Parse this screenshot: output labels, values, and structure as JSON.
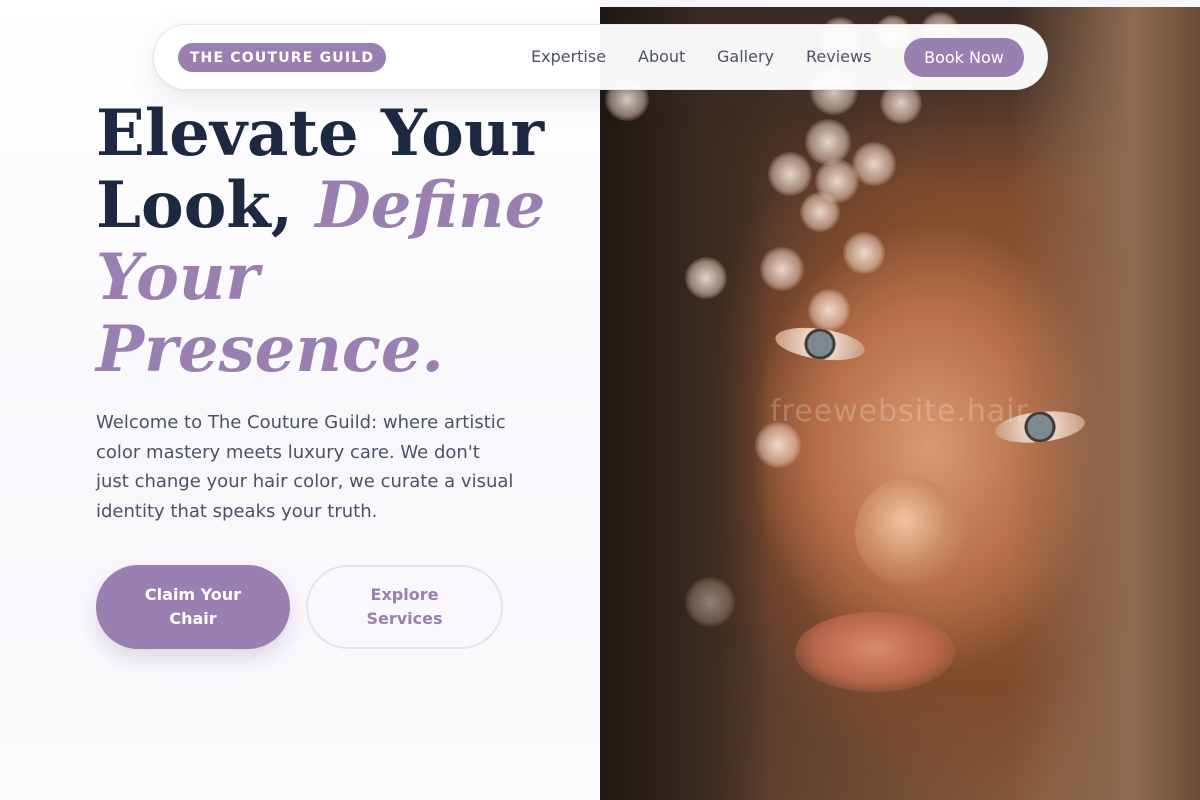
{
  "nav": {
    "logo": "THE COUTURE GUILD",
    "links": [
      "Expertise",
      "About",
      "Gallery",
      "Reviews"
    ],
    "cta": "Book Now"
  },
  "hero": {
    "headline_line1": "Elevate Your",
    "headline_line2_plain": "Look, ",
    "headline_line2_accent": "Define",
    "headline_line3_accent": "Your",
    "headline_line4_accent": "Presence.",
    "intro": "Welcome to The Couture Guild: where artistic color mastery meets luxury care. We don't just change your hair color, we curate a visual identity that speaks your truth.",
    "primary_cta": "Claim Your Chair",
    "secondary_cta": "Explore Services",
    "image_watermark": "freewebsite.hair"
  },
  "colors": {
    "accent": "#9a80b1",
    "heading": "#1d2940",
    "body_text": "#4a5365"
  }
}
